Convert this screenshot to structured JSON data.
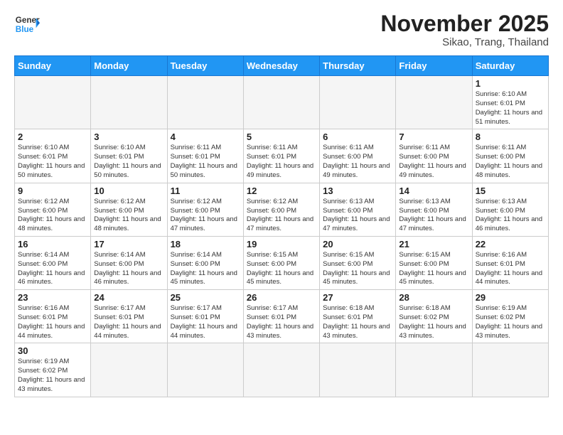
{
  "header": {
    "logo_general": "General",
    "logo_blue": "Blue",
    "month_title": "November 2025",
    "location": "Sikao, Trang, Thailand"
  },
  "weekdays": [
    "Sunday",
    "Monday",
    "Tuesday",
    "Wednesday",
    "Thursday",
    "Friday",
    "Saturday"
  ],
  "days": [
    {
      "date": "",
      "empty": true
    },
    {
      "date": "",
      "empty": true
    },
    {
      "date": "",
      "empty": true
    },
    {
      "date": "",
      "empty": true
    },
    {
      "date": "",
      "empty": true
    },
    {
      "date": "",
      "empty": true
    },
    {
      "date": "1",
      "sunrise": "Sunrise: 6:10 AM",
      "sunset": "Sunset: 6:01 PM",
      "daylight": "Daylight: 11 hours and 51 minutes."
    },
    {
      "date": "2",
      "sunrise": "Sunrise: 6:10 AM",
      "sunset": "Sunset: 6:01 PM",
      "daylight": "Daylight: 11 hours and 50 minutes."
    },
    {
      "date": "3",
      "sunrise": "Sunrise: 6:10 AM",
      "sunset": "Sunset: 6:01 PM",
      "daylight": "Daylight: 11 hours and 50 minutes."
    },
    {
      "date": "4",
      "sunrise": "Sunrise: 6:11 AM",
      "sunset": "Sunset: 6:01 PM",
      "daylight": "Daylight: 11 hours and 50 minutes."
    },
    {
      "date": "5",
      "sunrise": "Sunrise: 6:11 AM",
      "sunset": "Sunset: 6:01 PM",
      "daylight": "Daylight: 11 hours and 49 minutes."
    },
    {
      "date": "6",
      "sunrise": "Sunrise: 6:11 AM",
      "sunset": "Sunset: 6:00 PM",
      "daylight": "Daylight: 11 hours and 49 minutes."
    },
    {
      "date": "7",
      "sunrise": "Sunrise: 6:11 AM",
      "sunset": "Sunset: 6:00 PM",
      "daylight": "Daylight: 11 hours and 49 minutes."
    },
    {
      "date": "8",
      "sunrise": "Sunrise: 6:11 AM",
      "sunset": "Sunset: 6:00 PM",
      "daylight": "Daylight: 11 hours and 48 minutes."
    },
    {
      "date": "9",
      "sunrise": "Sunrise: 6:12 AM",
      "sunset": "Sunset: 6:00 PM",
      "daylight": "Daylight: 11 hours and 48 minutes."
    },
    {
      "date": "10",
      "sunrise": "Sunrise: 6:12 AM",
      "sunset": "Sunset: 6:00 PM",
      "daylight": "Daylight: 11 hours and 48 minutes."
    },
    {
      "date": "11",
      "sunrise": "Sunrise: 6:12 AM",
      "sunset": "Sunset: 6:00 PM",
      "daylight": "Daylight: 11 hours and 47 minutes."
    },
    {
      "date": "12",
      "sunrise": "Sunrise: 6:12 AM",
      "sunset": "Sunset: 6:00 PM",
      "daylight": "Daylight: 11 hours and 47 minutes."
    },
    {
      "date": "13",
      "sunrise": "Sunrise: 6:13 AM",
      "sunset": "Sunset: 6:00 PM",
      "daylight": "Daylight: 11 hours and 47 minutes."
    },
    {
      "date": "14",
      "sunrise": "Sunrise: 6:13 AM",
      "sunset": "Sunset: 6:00 PM",
      "daylight": "Daylight: 11 hours and 47 minutes."
    },
    {
      "date": "15",
      "sunrise": "Sunrise: 6:13 AM",
      "sunset": "Sunset: 6:00 PM",
      "daylight": "Daylight: 11 hours and 46 minutes."
    },
    {
      "date": "16",
      "sunrise": "Sunrise: 6:14 AM",
      "sunset": "Sunset: 6:00 PM",
      "daylight": "Daylight: 11 hours and 46 minutes."
    },
    {
      "date": "17",
      "sunrise": "Sunrise: 6:14 AM",
      "sunset": "Sunset: 6:00 PM",
      "daylight": "Daylight: 11 hours and 46 minutes."
    },
    {
      "date": "18",
      "sunrise": "Sunrise: 6:14 AM",
      "sunset": "Sunset: 6:00 PM",
      "daylight": "Daylight: 11 hours and 45 minutes."
    },
    {
      "date": "19",
      "sunrise": "Sunrise: 6:15 AM",
      "sunset": "Sunset: 6:00 PM",
      "daylight": "Daylight: 11 hours and 45 minutes."
    },
    {
      "date": "20",
      "sunrise": "Sunrise: 6:15 AM",
      "sunset": "Sunset: 6:00 PM",
      "daylight": "Daylight: 11 hours and 45 minutes."
    },
    {
      "date": "21",
      "sunrise": "Sunrise: 6:15 AM",
      "sunset": "Sunset: 6:00 PM",
      "daylight": "Daylight: 11 hours and 45 minutes."
    },
    {
      "date": "22",
      "sunrise": "Sunrise: 6:16 AM",
      "sunset": "Sunset: 6:01 PM",
      "daylight": "Daylight: 11 hours and 44 minutes."
    },
    {
      "date": "23",
      "sunrise": "Sunrise: 6:16 AM",
      "sunset": "Sunset: 6:01 PM",
      "daylight": "Daylight: 11 hours and 44 minutes."
    },
    {
      "date": "24",
      "sunrise": "Sunrise: 6:17 AM",
      "sunset": "Sunset: 6:01 PM",
      "daylight": "Daylight: 11 hours and 44 minutes."
    },
    {
      "date": "25",
      "sunrise": "Sunrise: 6:17 AM",
      "sunset": "Sunset: 6:01 PM",
      "daylight": "Daylight: 11 hours and 44 minutes."
    },
    {
      "date": "26",
      "sunrise": "Sunrise: 6:17 AM",
      "sunset": "Sunset: 6:01 PM",
      "daylight": "Daylight: 11 hours and 43 minutes."
    },
    {
      "date": "27",
      "sunrise": "Sunrise: 6:18 AM",
      "sunset": "Sunset: 6:01 PM",
      "daylight": "Daylight: 11 hours and 43 minutes."
    },
    {
      "date": "28",
      "sunrise": "Sunrise: 6:18 AM",
      "sunset": "Sunset: 6:02 PM",
      "daylight": "Daylight: 11 hours and 43 minutes."
    },
    {
      "date": "29",
      "sunrise": "Sunrise: 6:19 AM",
      "sunset": "Sunset: 6:02 PM",
      "daylight": "Daylight: 11 hours and 43 minutes."
    },
    {
      "date": "30",
      "sunrise": "Sunrise: 6:19 AM",
      "sunset": "Sunset: 6:02 PM",
      "daylight": "Daylight: 11 hours and 43 minutes."
    },
    {
      "date": "",
      "empty": true
    },
    {
      "date": "",
      "empty": true
    },
    {
      "date": "",
      "empty": true
    },
    {
      "date": "",
      "empty": true
    },
    {
      "date": "",
      "empty": true
    },
    {
      "date": "",
      "empty": true
    }
  ]
}
